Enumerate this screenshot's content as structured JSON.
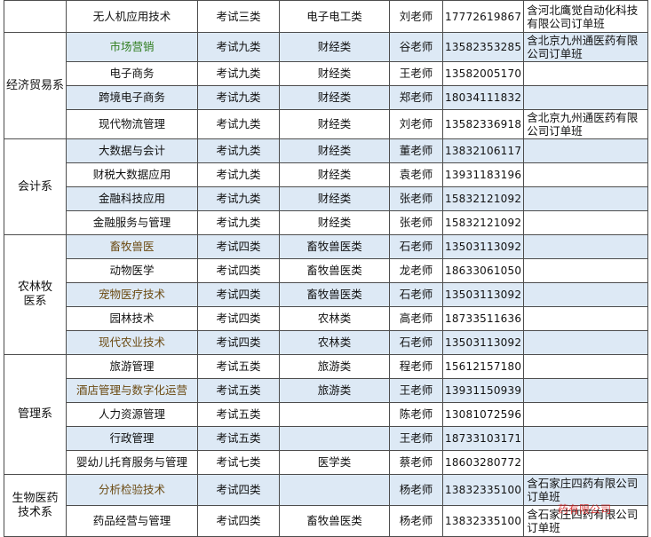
{
  "colors": {
    "shaded_row": "#dde9f5",
    "border": "#4d4d4d",
    "stamp_red": "#d21818",
    "green_text": "#2f7d1e"
  },
  "rows": [
    {
      "major": "无人机应用技术",
      "exam": "考试三类",
      "category": "电子电工类",
      "teacher": "刘老师",
      "phone": "17772619867",
      "note": "含河北鹰觉自动化科技有限公司订单班"
    },
    {
      "major": "市场营销",
      "exam": "考试九类",
      "category": "财经类",
      "teacher": "谷老师",
      "phone": "13582353285",
      "note": "含北京九州通医药有限公司订单班"
    },
    {
      "major": "电子商务",
      "exam": "考试九类",
      "category": "财经类",
      "teacher": "王老师",
      "phone": "13582005170",
      "note": ""
    },
    {
      "major": "跨境电子商务",
      "exam": "考试九类",
      "category": "财经类",
      "teacher": "郑老师",
      "phone": "18034111832",
      "note": ""
    },
    {
      "major": "现代物流管理",
      "exam": "考试九类",
      "category": "财经类",
      "teacher": "刘老师",
      "phone": "13582336918",
      "note": "含北京九州通医药有限公司订单班"
    },
    {
      "major": "大数据与会计",
      "exam": "考试九类",
      "category": "财经类",
      "teacher": "董老师",
      "phone": "13832106117",
      "note": ""
    },
    {
      "major": "财税大数据应用",
      "exam": "考试九类",
      "category": "财经类",
      "teacher": "袁老师",
      "phone": "13931183196",
      "note": ""
    },
    {
      "major": "金融科技应用",
      "exam": "考试九类",
      "category": "财经类",
      "teacher": "张老师",
      "phone": "15832121092",
      "note": ""
    },
    {
      "major": "金融服务与管理",
      "exam": "考试九类",
      "category": "财经类",
      "teacher": "张老师",
      "phone": "15832121092",
      "note": ""
    },
    {
      "major": "畜牧兽医",
      "exam": "考试四类",
      "category": "畜牧兽医类",
      "teacher": "石老师",
      "phone": "13503113092",
      "note": ""
    },
    {
      "major": "动物医学",
      "exam": "考试四类",
      "category": "畜牧兽医类",
      "teacher": "龙老师",
      "phone": "18633061050",
      "note": ""
    },
    {
      "major": "宠物医疗技术",
      "exam": "考试四类",
      "category": "畜牧兽医类",
      "teacher": "石老师",
      "phone": "13503113092",
      "note": ""
    },
    {
      "major": "园林技术",
      "exam": "考试四类",
      "category": "农林类",
      "teacher": "高老师",
      "phone": "18733511636",
      "note": ""
    },
    {
      "major": "现代农业技术",
      "exam": "考试四类",
      "category": "农林类",
      "teacher": "石老师",
      "phone": "13503113092",
      "note": ""
    },
    {
      "major": "旅游管理",
      "exam": "考试五类",
      "category": "旅游类",
      "teacher": "程老师",
      "phone": "15612157180",
      "note": ""
    },
    {
      "major": "酒店管理与数字化运营",
      "exam": "考试五类",
      "category": "旅游类",
      "teacher": "王老师",
      "phone": "13931150939",
      "note": ""
    },
    {
      "major": "人力资源管理",
      "exam": "考试五类",
      "category": "",
      "teacher": "陈老师",
      "phone": "13081072596",
      "note": ""
    },
    {
      "major": "行政管理",
      "exam": "考试五类",
      "category": "",
      "teacher": "王老师",
      "phone": "18733103171",
      "note": ""
    },
    {
      "major": "婴幼儿托育服务与管理",
      "exam": "考试七类",
      "category": "医学类",
      "teacher": "蔡老师",
      "phone": "18603280772",
      "note": ""
    },
    {
      "major": "分析检验技术",
      "exam": "考试四类",
      "category": "",
      "teacher": "杨老师",
      "phone": "13832335100",
      "note": "含石家庄四药有限公司订单班"
    },
    {
      "major": "药品经营与管理",
      "exam": "考试四类",
      "category": "畜牧兽医类",
      "teacher": "杨老师",
      "phone": "13832335100",
      "note": "含石家庄四药有限公司订单班"
    }
  ],
  "departments": [
    {
      "name": "经济贸易系"
    },
    {
      "name": "会计系"
    },
    {
      "name": "农林牧医系"
    },
    {
      "name": "管理系"
    },
    {
      "name": "生物医药技术系"
    }
  ],
  "stamp": {
    "text": "药有限公司"
  }
}
